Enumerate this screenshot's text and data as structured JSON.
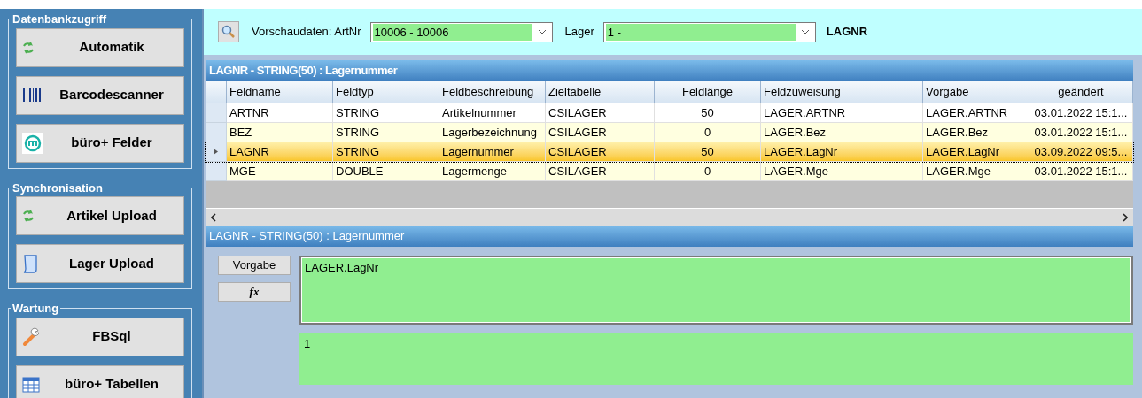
{
  "sidebar": {
    "groups": [
      {
        "title": "Datenbankzugriff",
        "buttons": [
          {
            "label": "Automatik",
            "kind": "sync"
          },
          {
            "label": "Barcodescanner",
            "kind": "barcode"
          },
          {
            "label": "büro+ Felder",
            "kind": "logo"
          }
        ]
      },
      {
        "title": "Synchronisation",
        "buttons": [
          {
            "label": "Artikel Upload",
            "kind": "sync"
          },
          {
            "label": "Lager Upload",
            "kind": "document"
          }
        ]
      },
      {
        "title": "Wartung",
        "buttons": [
          {
            "label": "FBSql",
            "kind": "wrench"
          },
          {
            "label": "büro+ Tabellen",
            "kind": "table"
          }
        ]
      }
    ]
  },
  "toolbar": {
    "preview_label": "Vorschaudaten: ArtNr",
    "preview_value": "10006 - 10006",
    "lager_label": "Lager",
    "lager_value": "1 -",
    "field_name": "LAGNR"
  },
  "grid": {
    "title": "LAGNR - STRING(50) : Lagernummer",
    "columns": [
      {
        "label": "Feldname",
        "kind": "text"
      },
      {
        "label": "Feldtyp",
        "kind": "text"
      },
      {
        "label": "Feldbeschreibung",
        "kind": "text"
      },
      {
        "label": "Zieltabelle",
        "kind": "text"
      },
      {
        "label": "Feldlänge",
        "kind": "number"
      },
      {
        "label": "Feldzuweisung",
        "kind": "text"
      },
      {
        "label": "Vorgabe",
        "kind": "text"
      },
      {
        "label": "geändert",
        "kind": "date"
      }
    ],
    "rows": [
      {
        "selected": false,
        "cells": [
          "ARTNR",
          "STRING",
          "Artikelnummer",
          "CSILAGER",
          "50",
          "LAGER.ARTNR",
          "LAGER.ARTNR",
          "03.01.2022 15:1..."
        ]
      },
      {
        "selected": false,
        "cells": [
          "BEZ",
          "STRING",
          "Lagerbezeichnung",
          "CSILAGER",
          "0",
          "LAGER.Bez",
          "LAGER.Bez",
          "03.01.2022 15:1..."
        ]
      },
      {
        "selected": true,
        "cells": [
          "LAGNR",
          "STRING",
          "Lagernummer",
          "CSILAGER",
          "50",
          "LAGER.LagNr",
          "LAGER.LagNr",
          "03.09.2022 09:5..."
        ]
      },
      {
        "selected": false,
        "cells": [
          "MGE",
          "DOUBLE",
          "Lagermenge",
          "CSILAGER",
          "0",
          "LAGER.Mge",
          "LAGER.Mge",
          "03.01.2022 15:1..."
        ]
      }
    ]
  },
  "detail": {
    "title": "LAGNR - STRING(50) : Lagernummer",
    "default_button": "Vorgabe",
    "formula_button": "fx",
    "expression": "LAGER.LagNr",
    "result": "1"
  }
}
